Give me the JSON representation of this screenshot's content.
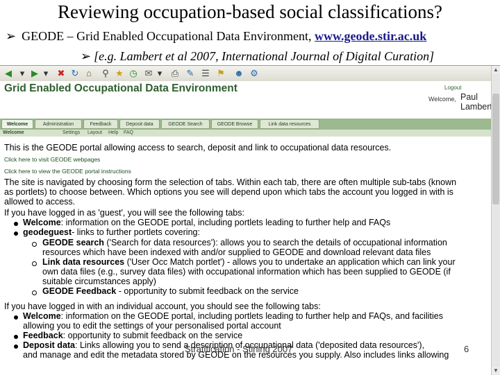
{
  "slide": {
    "title": "Reviewing occupation-based social classifications?",
    "bullet_text": "GEODE – Grid Enabled Occupational Data Environment,",
    "bullet_link": "www.geode.stir.ac.uk",
    "sub_bullet": "[e.g. Lambert et al 2007, International Journal of Digital Curation]",
    "footer_center": "Stratification - Stirling 2007",
    "page_number": "6"
  },
  "portal": {
    "title": "Grid Enabled Occupational Data Environment",
    "logout": "Logout",
    "welcome_prefix": "Welcome,",
    "user_name": "Paul Lambert",
    "tabs": [
      {
        "label": "Welcome"
      },
      {
        "label": "Administration"
      },
      {
        "label": "Feedback"
      },
      {
        "label": "Deposit data"
      },
      {
        "label": "GEODE Search"
      },
      {
        "label": "GEODE Browse"
      },
      {
        "label": "Link data resources"
      }
    ],
    "subtabs": [
      {
        "label": "Welcome"
      },
      {
        "label": "Settings"
      },
      {
        "label": "Layout"
      },
      {
        "label": "Help"
      },
      {
        "label": "FAQ"
      }
    ]
  },
  "content": {
    "intro": "This is the GEODE portal allowing access to search, deposit and link to occupational data resources.",
    "link1": "Click here to visit GEODE webpages",
    "link2": "Click here to view the GEODE portal instructions",
    "nav1": "The site is navigated by choosing form the selection of tabs. Within each tab, there are often multiple sub-tabs (known",
    "nav2": "as portlets) to choose between. Which options you see will depend upon which tabs the account you logged in with is",
    "nav3": "allowed to access.",
    "guest_intro": "If you have logged in as 'guest', you will see the following tabs:",
    "g_welcome_bold": "Welcome",
    "g_welcome_rest": ": information on the GEODE portal, including portlets leading to further help and FAQs",
    "g_geoguest_bold": "geodeguest",
    "g_geoguest_rest": "- links to further portlets covering:",
    "s_search_bold": "GEODE search",
    "s_search_rest1": " ('Search for data resources'): allows you to search the details of occupational information",
    "s_search_rest2": "resources which have been indexed with and/or supplied to GEODE and download relevant data files",
    "s_link_bold": "Link data resources",
    "s_link_rest1": " ('User Occ Match portlet') - allows you to undertake an application which can link your",
    "s_link_rest2": "own data files (e.g., survey data files) with occupational information which has been supplied to GEODE (if",
    "s_link_rest3": "suitable circumstances apply)",
    "s_feedback_bold": "GEODE Feedback",
    "s_feedback_rest": " - opportunity to submit feedback on the service",
    "indiv_intro": "If you have logged in with an individual account, you should see the following tabs:",
    "i_welcome_bold": "Welcome",
    "i_welcome_rest1": ": information on the GEODE portal, including portlets leading to further help and FAQs, and facilities",
    "i_welcome_rest2": "allowing you to edit the settings of your personalised portal account",
    "i_feedback_bold": "Feedback",
    "i_feedback_rest": ": opportunity to submit feedback on the service",
    "i_deposit_bold": "Deposit data",
    "i_deposit_rest1": ": Links allowing you to send a description of occupational data ('deposited data resources'),",
    "i_deposit_rest2": "and manage and edit the metadata stored by GEODE on the resources you supply. Also includes links allowing"
  }
}
